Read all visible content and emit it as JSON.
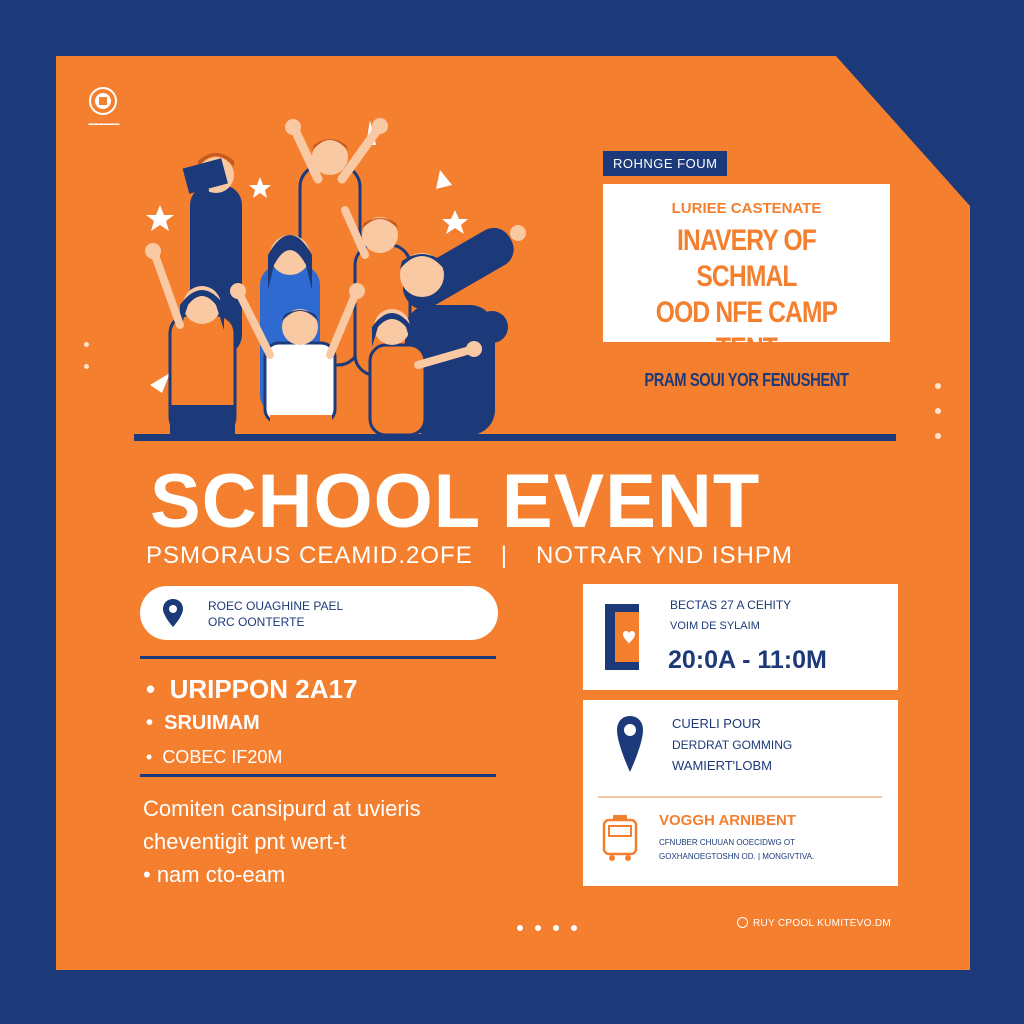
{
  "colors": {
    "background": "#1c3a7a",
    "panel": "#f47f2e",
    "accent_light": "#fde3cf"
  },
  "tag": "ROHNGE FOUM",
  "info_box": {
    "kicker": "LURIEE CASTENATE",
    "headline_1": "INAVERY OF SCHMAL",
    "headline_2": "OOD NFE CAMP TENT",
    "sub": "PRAM SOUI YOR FENUSHENT"
  },
  "title": "SCHOOL EVENT",
  "subline": {
    "left": "PSMORAUS CEAMID.2OFE",
    "separator": "|",
    "right": "NOTRAR YND ISHPM"
  },
  "location": {
    "line1": "ROEC OUAGHINE PAEL",
    "line2": "ORC OONTERTE",
    "icon": "map-pin-icon"
  },
  "bullets": [
    "URIPPON 2A17",
    "SRUIMAM",
    "COBEC IF20M"
  ],
  "description": [
    "Comiten cansipurd at uvieris",
    "cheventigit pnt wert-t",
    "• nam cto-eam"
  ],
  "time_card": {
    "line1": "BECTAS 27 A CEHITY",
    "line2": "VOIM DE SYLAIM",
    "time": "20:0A - 11:0M",
    "icon": "calendar-icon"
  },
  "venue_card": {
    "line1": "CUERLI POUR",
    "line2": "DERDRAT GOMMING",
    "line3": "WAMIERT'LOBM",
    "icon": "map-pin-icon",
    "transport_title": "VOGGH ARNIBENT",
    "transport_line1": "CFNUBER CHUUAN OOECIDWG OT",
    "transport_line2": "GOXHANOEGTOSHN OD. | MONGIVTIVA.",
    "transport_icon": "bus-icon"
  },
  "footer": {
    "text": "RUY CPOOL KUMITEVO.DM",
    "icon": "globe-icon"
  }
}
